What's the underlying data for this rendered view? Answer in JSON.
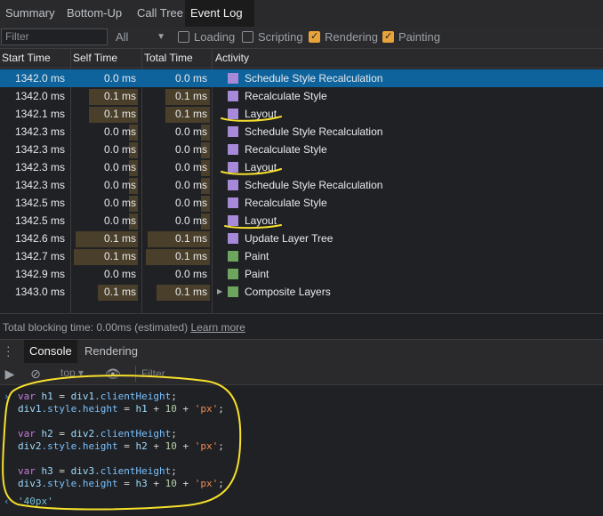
{
  "tabs": [
    "Summary",
    "Bottom-Up",
    "Call Tree",
    "Event Log"
  ],
  "active_tab": "Event Log",
  "filter": {
    "placeholder": "Filter",
    "duration_select": "All",
    "checkboxes": [
      {
        "label": "Loading",
        "checked": false
      },
      {
        "label": "Scripting",
        "checked": false
      },
      {
        "label": "Rendering",
        "checked": true
      },
      {
        "label": "Painting",
        "checked": true
      }
    ]
  },
  "columns": [
    "Start Time",
    "Self Time",
    "Total Time",
    "Activity"
  ],
  "colors": {
    "rendering": "#a689d9",
    "painting": "#6ea55e",
    "selection": "#0e639c",
    "annotation": "#f7e02c"
  },
  "events": [
    {
      "start": "1342.0 ms",
      "self": "0.0 ms",
      "total": "0.0 ms",
      "activity": "Schedule Style Recalculation",
      "color": "#a689d9"
    },
    {
      "start": "1342.0 ms",
      "self": "0.1 ms",
      "total": "0.1 ms",
      "activity": "Recalculate Style",
      "color": "#a689d9"
    },
    {
      "start": "1342.1 ms",
      "self": "0.1 ms",
      "total": "0.1 ms",
      "activity": "Layout",
      "color": "#a689d9"
    },
    {
      "start": "1342.3 ms",
      "self": "0.0 ms",
      "total": "0.0 ms",
      "activity": "Schedule Style Recalculation",
      "color": "#a689d9"
    },
    {
      "start": "1342.3 ms",
      "self": "0.0 ms",
      "total": "0.0 ms",
      "activity": "Recalculate Style",
      "color": "#a689d9"
    },
    {
      "start": "1342.3 ms",
      "self": "0.0 ms",
      "total": "0.0 ms",
      "activity": "Layout",
      "color": "#a689d9"
    },
    {
      "start": "1342.3 ms",
      "self": "0.0 ms",
      "total": "0.0 ms",
      "activity": "Schedule Style Recalculation",
      "color": "#a689d9"
    },
    {
      "start": "1342.5 ms",
      "self": "0.0 ms",
      "total": "0.0 ms",
      "activity": "Recalculate Style",
      "color": "#a689d9"
    },
    {
      "start": "1342.5 ms",
      "self": "0.0 ms",
      "total": "0.0 ms",
      "activity": "Layout",
      "color": "#a689d9"
    },
    {
      "start": "1342.6 ms",
      "self": "0.1 ms",
      "total": "0.1 ms",
      "activity": "Update Layer Tree",
      "color": "#a689d9"
    },
    {
      "start": "1342.7 ms",
      "self": "0.1 ms",
      "total": "0.1 ms",
      "activity": "Paint",
      "color": "#6ea55e"
    },
    {
      "start": "1342.9 ms",
      "self": "0.0 ms",
      "total": "0.0 ms",
      "activity": "Paint",
      "color": "#6ea55e"
    },
    {
      "start": "1343.0 ms",
      "self": "0.1 ms",
      "total": "0.1 ms",
      "activity": "Composite Layers",
      "color": "#6ea55e",
      "expandable": true
    }
  ],
  "footer": {
    "text": "Total blocking time: 0.00ms (estimated)",
    "link": "Learn more"
  },
  "drawer_tabs": [
    "Console",
    "Rendering"
  ],
  "console_toolbar": {
    "context": "top",
    "filter_placeholder": "Filter"
  },
  "console_lines": [
    "var h1 = div1.clientHeight;",
    "div1.style.height = h1 + 10 + 'px';",
    "",
    "var h2 = div2.clientHeight;",
    "div2.style.height = h2 + 10 + 'px';",
    "",
    "var h3 = div3.clientHeight;",
    "div3.style.height = h3 + 10 + 'px';"
  ],
  "console_result": "'40px'"
}
